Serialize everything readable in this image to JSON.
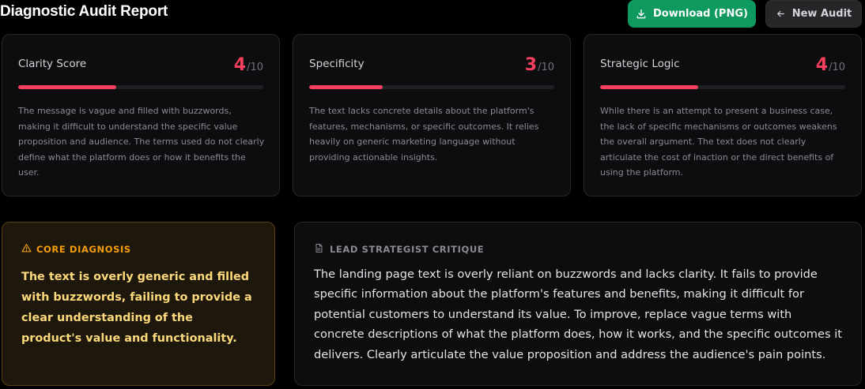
{
  "header": {
    "title": "Diagnostic Audit Report",
    "download_label": "Download (PNG)",
    "new_audit_label": "New Audit"
  },
  "metrics": [
    {
      "label": "Clarity Score",
      "score": "4",
      "max": "/10",
      "fraction": 0.4,
      "text": "The message is vague and filled with buzzwords, making it difficult to understand the specific value proposition and audience. The terms used do not clearly define what the platform does or how it benefits the user."
    },
    {
      "label": "Specificity",
      "score": "3",
      "max": "/10",
      "fraction": 0.3,
      "text": "The text lacks concrete details about the platform's features, mechanisms, or specific outcomes. It relies heavily on generic marketing language without providing actionable insights."
    },
    {
      "label": "Strategic Logic",
      "score": "4",
      "max": "/10",
      "fraction": 0.4,
      "text": "While there is an attempt to present a business case, the lack of specific mechanisms or outcomes weakens the overall argument. The text does not clearly articulate the cost of inaction or the direct benefits of using the platform."
    }
  ],
  "diagnosis": {
    "heading": "CORE DIAGNOSIS",
    "text": "The text is overly generic and filled with buzzwords, failing to provide a clear understanding of the product's value and functionality."
  },
  "critique": {
    "heading": "LEAD STRATEGIST CRITIQUE",
    "text": "The landing page text is overly reliant on buzzwords and lacks clarity. It fails to provide specific information about the platform's features and benefits, making it difficult for potential customers to understand its value. To improve, replace vague terms with concrete descriptions of what the platform does, how it works, and the specific outcomes it delivers. Clearly articulate the value proposition and address the audience's pain points."
  },
  "icons": {
    "download": "download-icon",
    "back": "arrow-left-icon",
    "warning": "warning-triangle-icon",
    "document": "document-icon"
  },
  "colors": {
    "accent_score": "#f43f5e",
    "download_button": "#0e9a5e",
    "diagnosis_text": "#fcd97a",
    "diagnosis_heading": "#f59e0b"
  }
}
